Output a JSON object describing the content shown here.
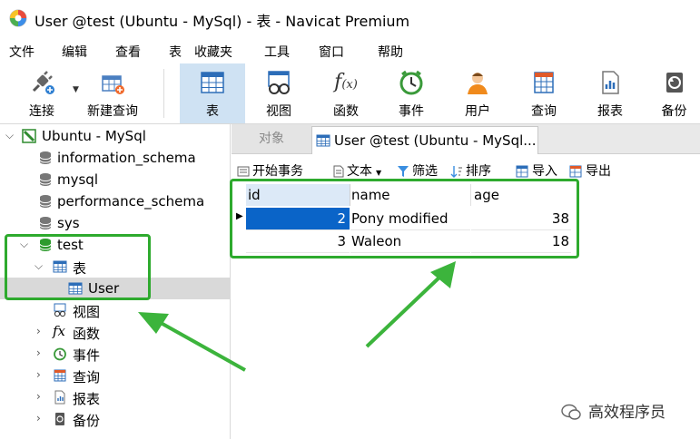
{
  "window": {
    "title": "User @test (Ubuntu - MySql) - 表 - Navicat Premium"
  },
  "menu": [
    "文件",
    "编辑",
    "查看",
    "表",
    "收藏夹",
    "工具",
    "窗口",
    "帮助"
  ],
  "toolbar": {
    "connect": "连接",
    "new_query": "新建查询",
    "table": "表",
    "view": "视图",
    "function": "函数",
    "event": "事件",
    "user": "用户",
    "query": "查询",
    "report": "报表",
    "backup": "备份"
  },
  "tree": {
    "connection": "Ubuntu - MySql",
    "databases": [
      "information_schema",
      "mysql",
      "performance_schema",
      "sys",
      "test"
    ],
    "tables_node": "表",
    "table_user": "User",
    "views": "视图",
    "functions": "函数",
    "events": "事件",
    "queries": "查询",
    "reports": "报表",
    "backups": "备份"
  },
  "tabs": {
    "objects": "对象",
    "active": "User @test (Ubuntu - MySql..."
  },
  "subtoolbar": {
    "begin_tx": "开始事务",
    "text": "文本",
    "filter": "筛选",
    "sort": "排序",
    "import": "导入",
    "export": "导出"
  },
  "grid": {
    "columns": [
      "id",
      "name",
      "age"
    ],
    "rows": [
      {
        "id": "2",
        "name": "Pony modified",
        "age": "38"
      },
      {
        "id": "3",
        "name": "Waleon",
        "age": "18"
      }
    ]
  },
  "watermark": "高效程序员",
  "colors": {
    "highlight": "#2eaa2e",
    "selected_cell": "#0a64c8",
    "active_tool": "#cfe2f3"
  }
}
